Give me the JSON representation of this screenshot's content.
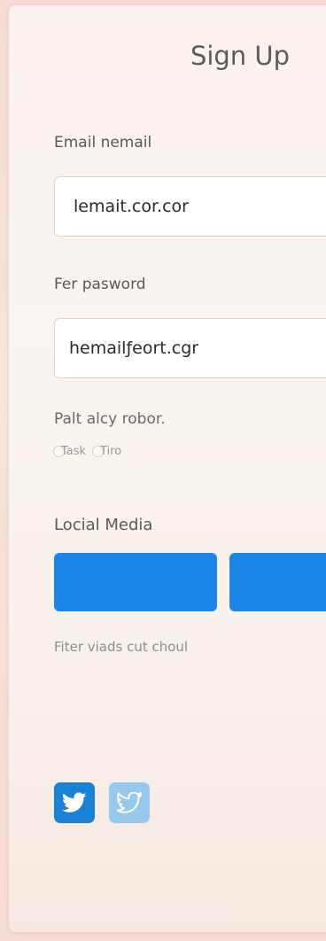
{
  "form": {
    "title": "Sign Up",
    "email": {
      "label": "Email nemail",
      "value": "lemait.cor.cor"
    },
    "password": {
      "label": "Fer pasword",
      "value": "hemailƒeort.cgr"
    },
    "options": {
      "label": "Palt alcy robor.",
      "items": [
        "Task",
        "Tiro"
      ]
    },
    "social": {
      "heading": "Locial Media",
      "note": "Fiter viads cut choul",
      "colors": {
        "button": "#1c86e8",
        "twitter_dark": "#1a82d6",
        "twitter_light": "#97c8ee"
      },
      "icons": [
        "twitter-icon",
        "twitter-outline-icon"
      ]
    }
  }
}
